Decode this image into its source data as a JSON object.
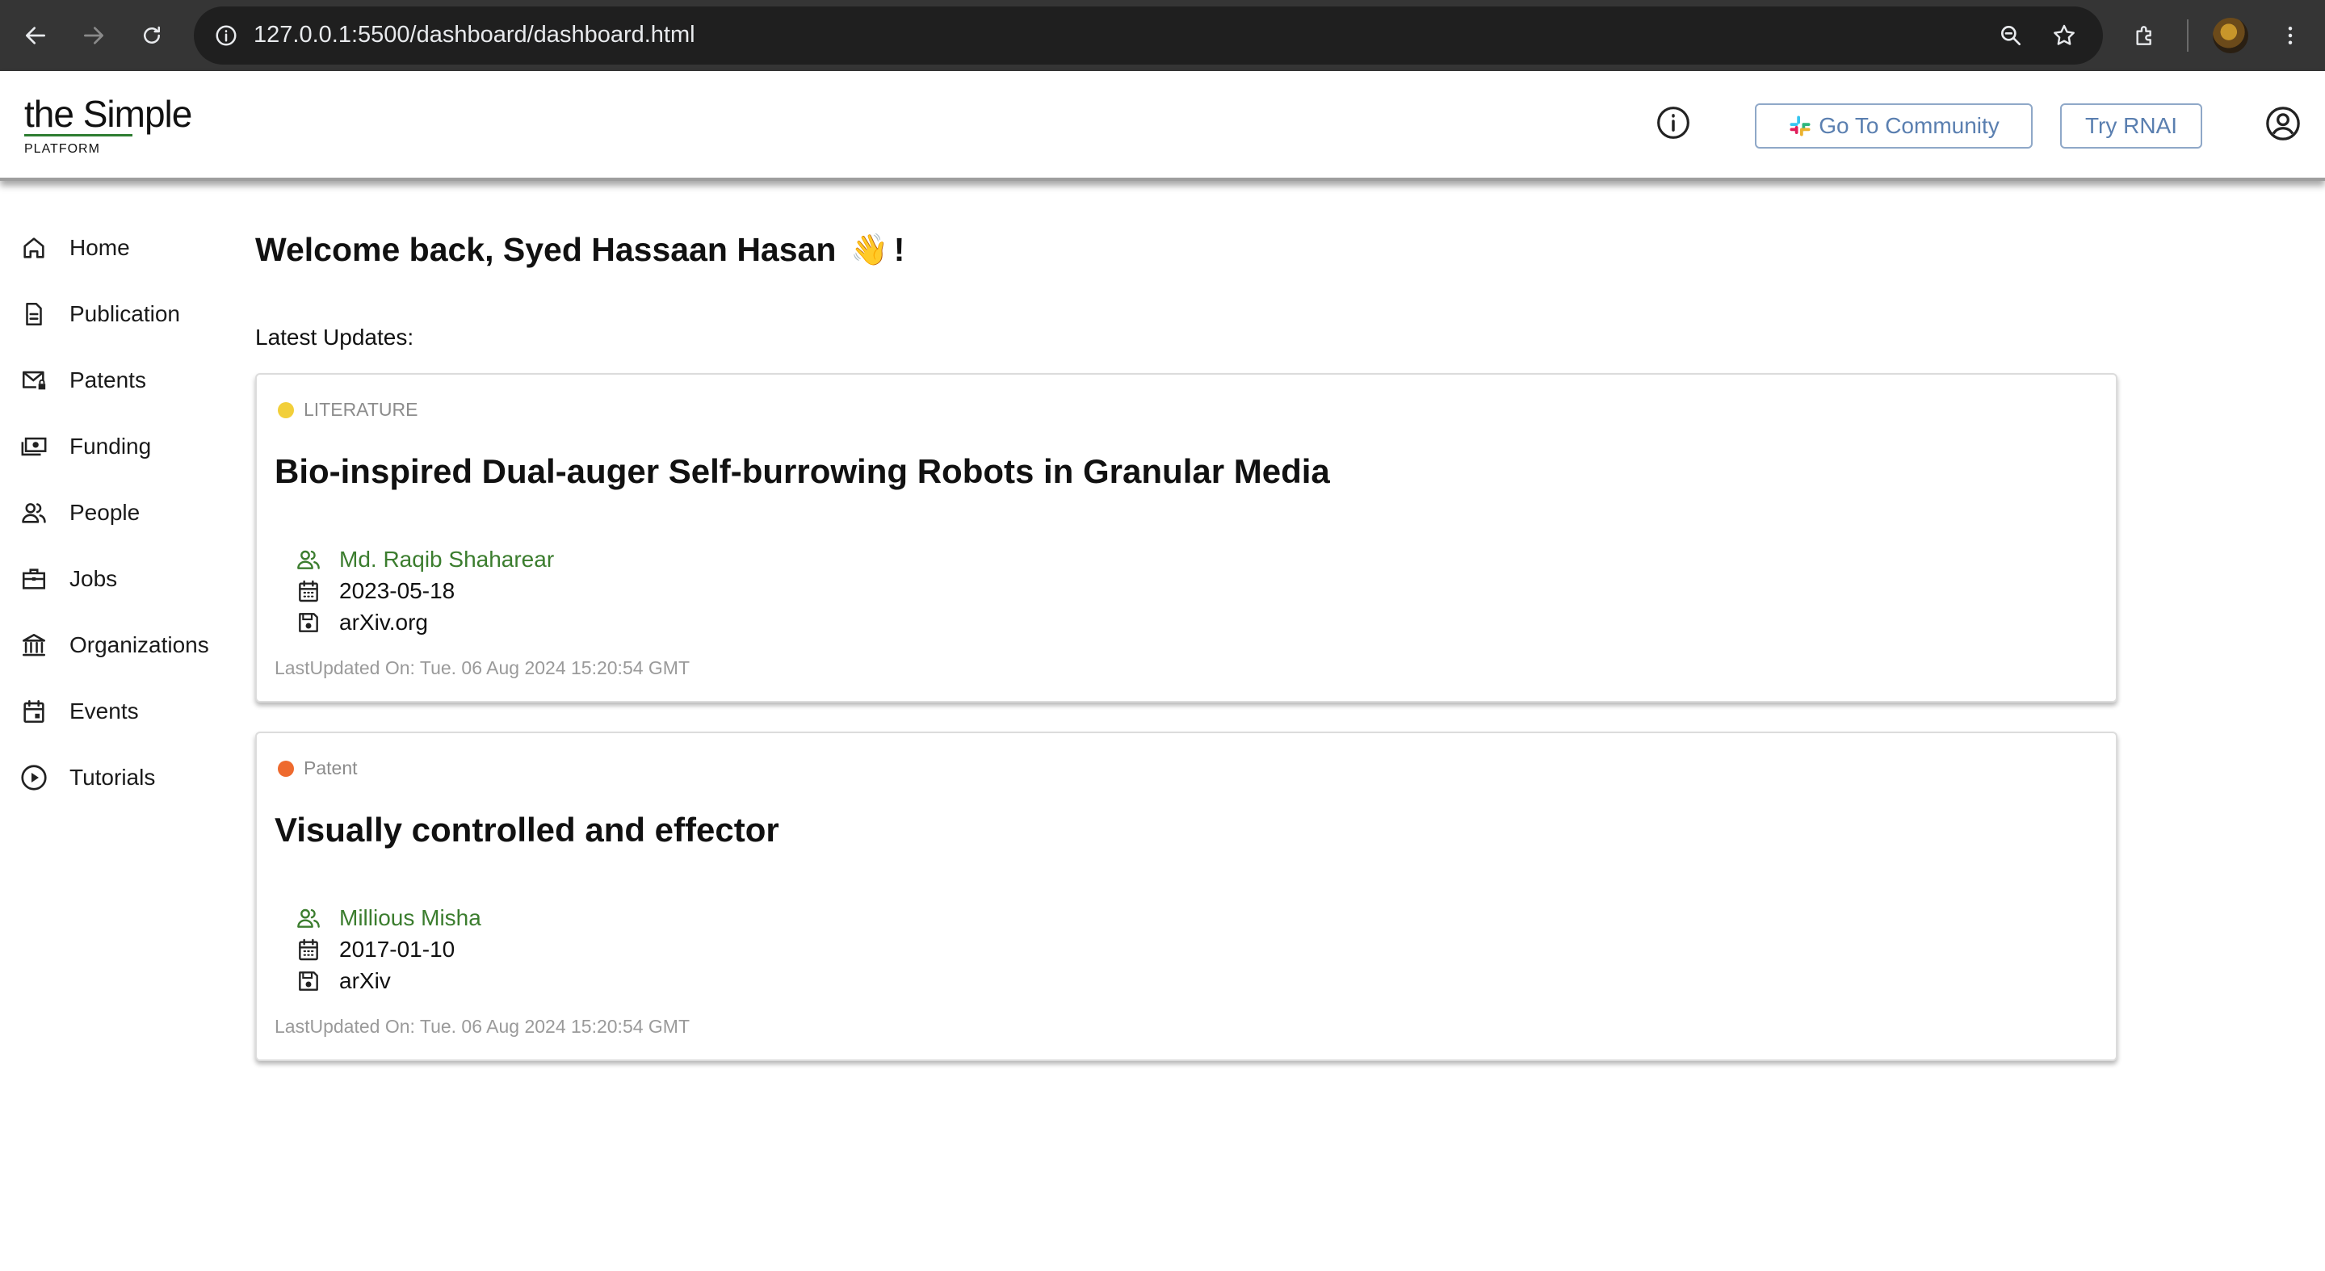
{
  "browser": {
    "url": "127.0.0.1:5500/dashboard/dashboard.html"
  },
  "header": {
    "logo_main": "the Simple",
    "logo_sub": "PLATFORM",
    "community_label": "Go To Community",
    "rnai_label": "Try RNAI"
  },
  "sidebar": {
    "items": [
      {
        "label": "Home",
        "icon": "home-icon"
      },
      {
        "label": "Publication",
        "icon": "document-icon"
      },
      {
        "label": "Patents",
        "icon": "mail-lock-icon"
      },
      {
        "label": "Funding",
        "icon": "money-icon"
      },
      {
        "label": "People",
        "icon": "people-icon"
      },
      {
        "label": "Jobs",
        "icon": "briefcase-icon"
      },
      {
        "label": "Organizations",
        "icon": "bank-icon"
      },
      {
        "label": "Events",
        "icon": "calendar-icon"
      },
      {
        "label": "Tutorials",
        "icon": "play-circle-icon"
      }
    ]
  },
  "main": {
    "welcome_prefix": "Welcome back, Syed Hassaan Hasan",
    "welcome_emoji": "👋",
    "welcome_suffix": "!",
    "updates_label": "Latest Updates:",
    "cards": [
      {
        "tag": "LITERATURE",
        "tag_color": "#f2cf3a",
        "title": "Bio-inspired Dual-auger Self-burrowing Robots in Granular Media",
        "author": "Md. Raqib Shaharear",
        "date": "2023-05-18",
        "source": "arXiv.org",
        "last_updated": "LastUpdated On: Tue. 06 Aug 2024 15:20:54 GMT"
      },
      {
        "tag": "Patent",
        "tag_color": "#ee6a2e",
        "title": "Visually controlled and effector",
        "author": "Millious Misha",
        "date": "2017-01-10",
        "source": "arXiv",
        "last_updated": "LastUpdated On: Tue. 06 Aug 2024 15:20:54 GMT"
      }
    ]
  },
  "colors": {
    "author_green": "#3b7d2e",
    "button_blue": "#5a7fb0"
  }
}
